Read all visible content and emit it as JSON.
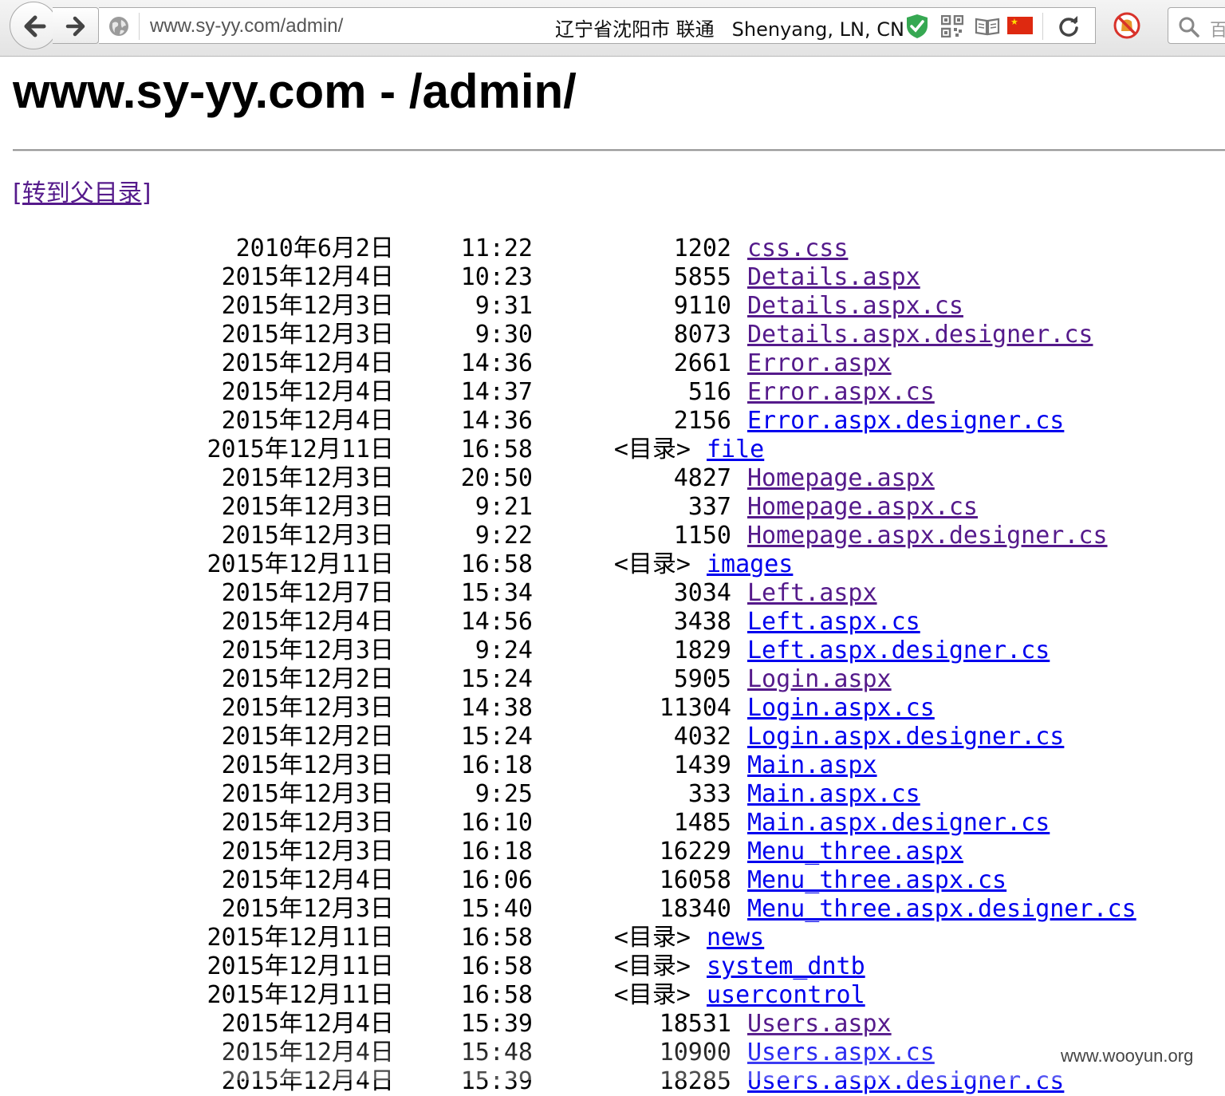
{
  "browser": {
    "url": "www.sy-yy.com/admin/",
    "geo_cn": "辽宁省沈阳市 联通",
    "geo_en": "Shenyang, LN, CN",
    "search_placeholder": "百"
  },
  "page": {
    "title": "www.sy-yy.com - /admin/",
    "parent_link": "[转到父目录]"
  },
  "listing": [
    {
      "date": "2010年6月2日",
      "time": "11:22",
      "size": "1202",
      "name": "css.css",
      "visited": true
    },
    {
      "date": "2015年12月4日",
      "time": "10:23",
      "size": "5855",
      "name": "Details.aspx",
      "visited": true
    },
    {
      "date": "2015年12月3日",
      "time": "9:31",
      "size": "9110",
      "name": "Details.aspx.cs",
      "visited": true
    },
    {
      "date": "2015年12月3日",
      "time": "9:30",
      "size": "8073",
      "name": "Details.aspx.designer.cs",
      "visited": true
    },
    {
      "date": "2015年12月4日",
      "time": "14:36",
      "size": "2661",
      "name": "Error.aspx",
      "visited": true
    },
    {
      "date": "2015年12月4日",
      "time": "14:37",
      "size": "516",
      "name": "Error.aspx.cs",
      "visited": true
    },
    {
      "date": "2015年12月4日",
      "time": "14:36",
      "size": "2156",
      "name": "Error.aspx.designer.cs",
      "visited": false
    },
    {
      "date": "2015年12月11日",
      "time": "16:58",
      "size": "<目录>",
      "name": "file",
      "visited": false,
      "dir": true
    },
    {
      "date": "2015年12月3日",
      "time": "20:50",
      "size": "4827",
      "name": "Homepage.aspx",
      "visited": true
    },
    {
      "date": "2015年12月3日",
      "time": "9:21",
      "size": "337",
      "name": "Homepage.aspx.cs",
      "visited": true
    },
    {
      "date": "2015年12月3日",
      "time": "9:22",
      "size": "1150",
      "name": "Homepage.aspx.designer.cs",
      "visited": true
    },
    {
      "date": "2015年12月11日",
      "time": "16:58",
      "size": "<目录>",
      "name": "images",
      "visited": false,
      "dir": true
    },
    {
      "date": "2015年12月7日",
      "time": "15:34",
      "size": "3034",
      "name": "Left.aspx",
      "visited": true
    },
    {
      "date": "2015年12月4日",
      "time": "14:56",
      "size": "3438",
      "name": "Left.aspx.cs",
      "visited": false
    },
    {
      "date": "2015年12月3日",
      "time": "9:24",
      "size": "1829",
      "name": "Left.aspx.designer.cs",
      "visited": false
    },
    {
      "date": "2015年12月2日",
      "time": "15:24",
      "size": "5905",
      "name": "Login.aspx",
      "visited": true
    },
    {
      "date": "2015年12月3日",
      "time": "14:38",
      "size": "11304",
      "name": "Login.aspx.cs",
      "visited": false
    },
    {
      "date": "2015年12月2日",
      "time": "15:24",
      "size": "4032",
      "name": "Login.aspx.designer.cs",
      "visited": false
    },
    {
      "date": "2015年12月3日",
      "time": "16:18",
      "size": "1439",
      "name": "Main.aspx",
      "visited": false
    },
    {
      "date": "2015年12月3日",
      "time": "9:25",
      "size": "333",
      "name": "Main.aspx.cs",
      "visited": false
    },
    {
      "date": "2015年12月3日",
      "time": "16:10",
      "size": "1485",
      "name": "Main.aspx.designer.cs",
      "visited": false
    },
    {
      "date": "2015年12月3日",
      "time": "16:18",
      "size": "16229",
      "name": "Menu_three.aspx",
      "visited": false
    },
    {
      "date": "2015年12月4日",
      "time": "16:06",
      "size": "16058",
      "name": "Menu_three.aspx.cs",
      "visited": false
    },
    {
      "date": "2015年12月3日",
      "time": "15:40",
      "size": "18340",
      "name": "Menu_three.aspx.designer.cs",
      "visited": false
    },
    {
      "date": "2015年12月11日",
      "time": "16:58",
      "size": "<目录>",
      "name": "news",
      "visited": false,
      "dir": true
    },
    {
      "date": "2015年12月11日",
      "time": "16:58",
      "size": "<目录>",
      "name": "system_dntb",
      "visited": false,
      "dir": true
    },
    {
      "date": "2015年12月11日",
      "time": "16:58",
      "size": "<目录>",
      "name": "usercontrol",
      "visited": false,
      "dir": true
    },
    {
      "date": "2015年12月4日",
      "time": "15:39",
      "size": "18531",
      "name": "Users.aspx",
      "visited": true
    },
    {
      "date": "2015年12月4日",
      "time": "15:48",
      "size": "10900",
      "name": "Users.aspx.cs",
      "visited": false
    },
    {
      "date": "2015年12月4日",
      "time": "15:39",
      "size": "18285",
      "name": "Users.aspx.designer.cs",
      "visited": false
    }
  ],
  "watermark": "www.wooyun.org",
  "colors": {
    "visited_link": "#551a8b",
    "unvisited_link": "#0000ee"
  }
}
